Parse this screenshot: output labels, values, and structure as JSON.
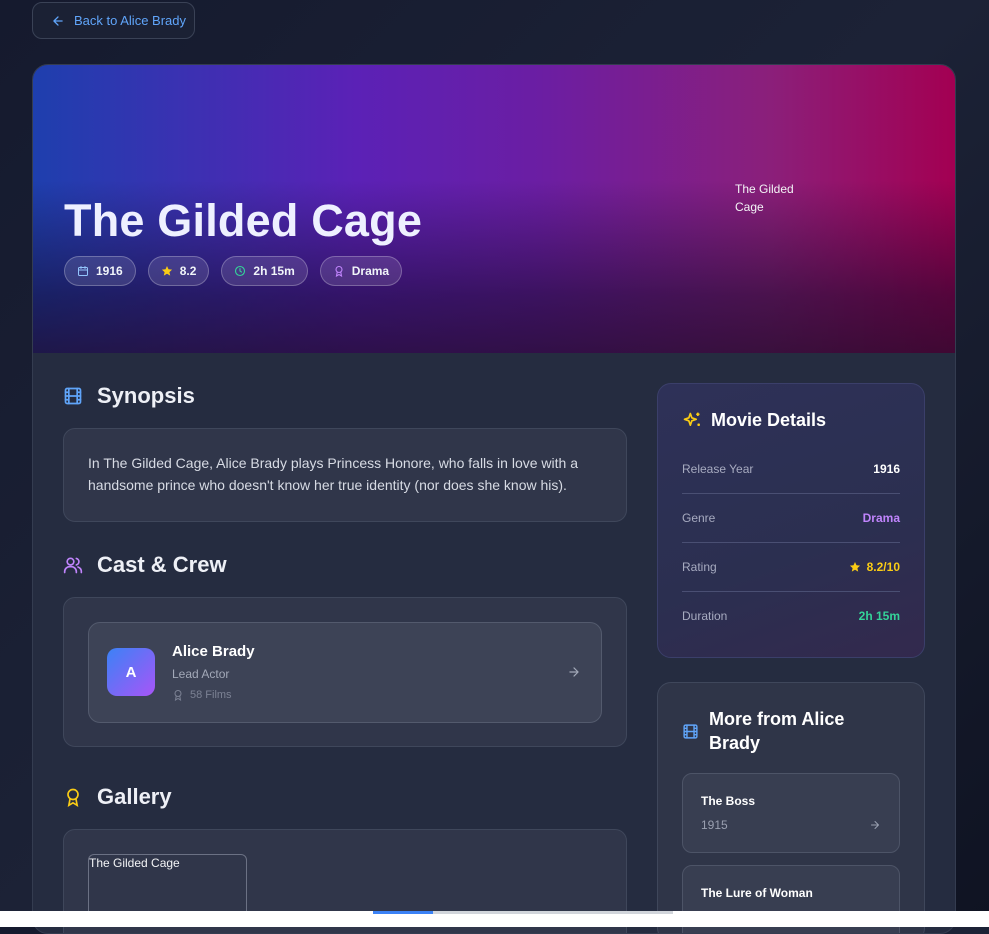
{
  "back_button": {
    "label": "Back to Alice Brady",
    "icon": "arrow-left-icon"
  },
  "hero": {
    "title": "The Gilded Cage",
    "poster_alt": "The Gilded Cage",
    "chips": [
      {
        "icon": "calendar-icon",
        "label": "1916",
        "icon_color": "#93c5fd"
      },
      {
        "icon": "star-icon",
        "label": "8.2",
        "icon_color": "#facc15"
      },
      {
        "icon": "clock-icon",
        "label": "2h 15m",
        "icon_color": "#34d399"
      },
      {
        "icon": "award-icon",
        "label": "Drama",
        "icon_color": "#c084fc"
      }
    ]
  },
  "synopsis": {
    "title": "Synopsis",
    "text": "In The Gilded Cage, Alice Brady plays Princess Honore, who falls in love with a handsome prince who doesn't know her true identity (nor does she know his)."
  },
  "cast": {
    "title": "Cast & Crew",
    "members": [
      {
        "initial": "A",
        "name": "Alice Brady",
        "role": "Lead Actor",
        "films": "58 Films"
      }
    ]
  },
  "gallery": {
    "title": "Gallery",
    "images": [
      {
        "alt": "The Gilded Cage"
      }
    ]
  },
  "details": {
    "title": "Movie Details",
    "rows": [
      {
        "label": "Release Year",
        "value": "1916",
        "color": "#ffffff"
      },
      {
        "label": "Genre",
        "value": "Drama",
        "color": "#c084fc"
      },
      {
        "label": "Rating",
        "value": "8.2/10",
        "color": "#facc15"
      },
      {
        "label": "Duration",
        "value": "2h 15m",
        "color": "#34d399"
      }
    ]
  },
  "more": {
    "title": "More from Alice Brady",
    "movies": [
      {
        "title": "The Boss",
        "year": "1915"
      },
      {
        "title": "The Lure of Woman",
        "year": ""
      }
    ]
  },
  "colors": {
    "accent_blue": "#60a5fa",
    "accent_purple": "#c084fc",
    "accent_yellow": "#facc15",
    "accent_green": "#34d399"
  }
}
